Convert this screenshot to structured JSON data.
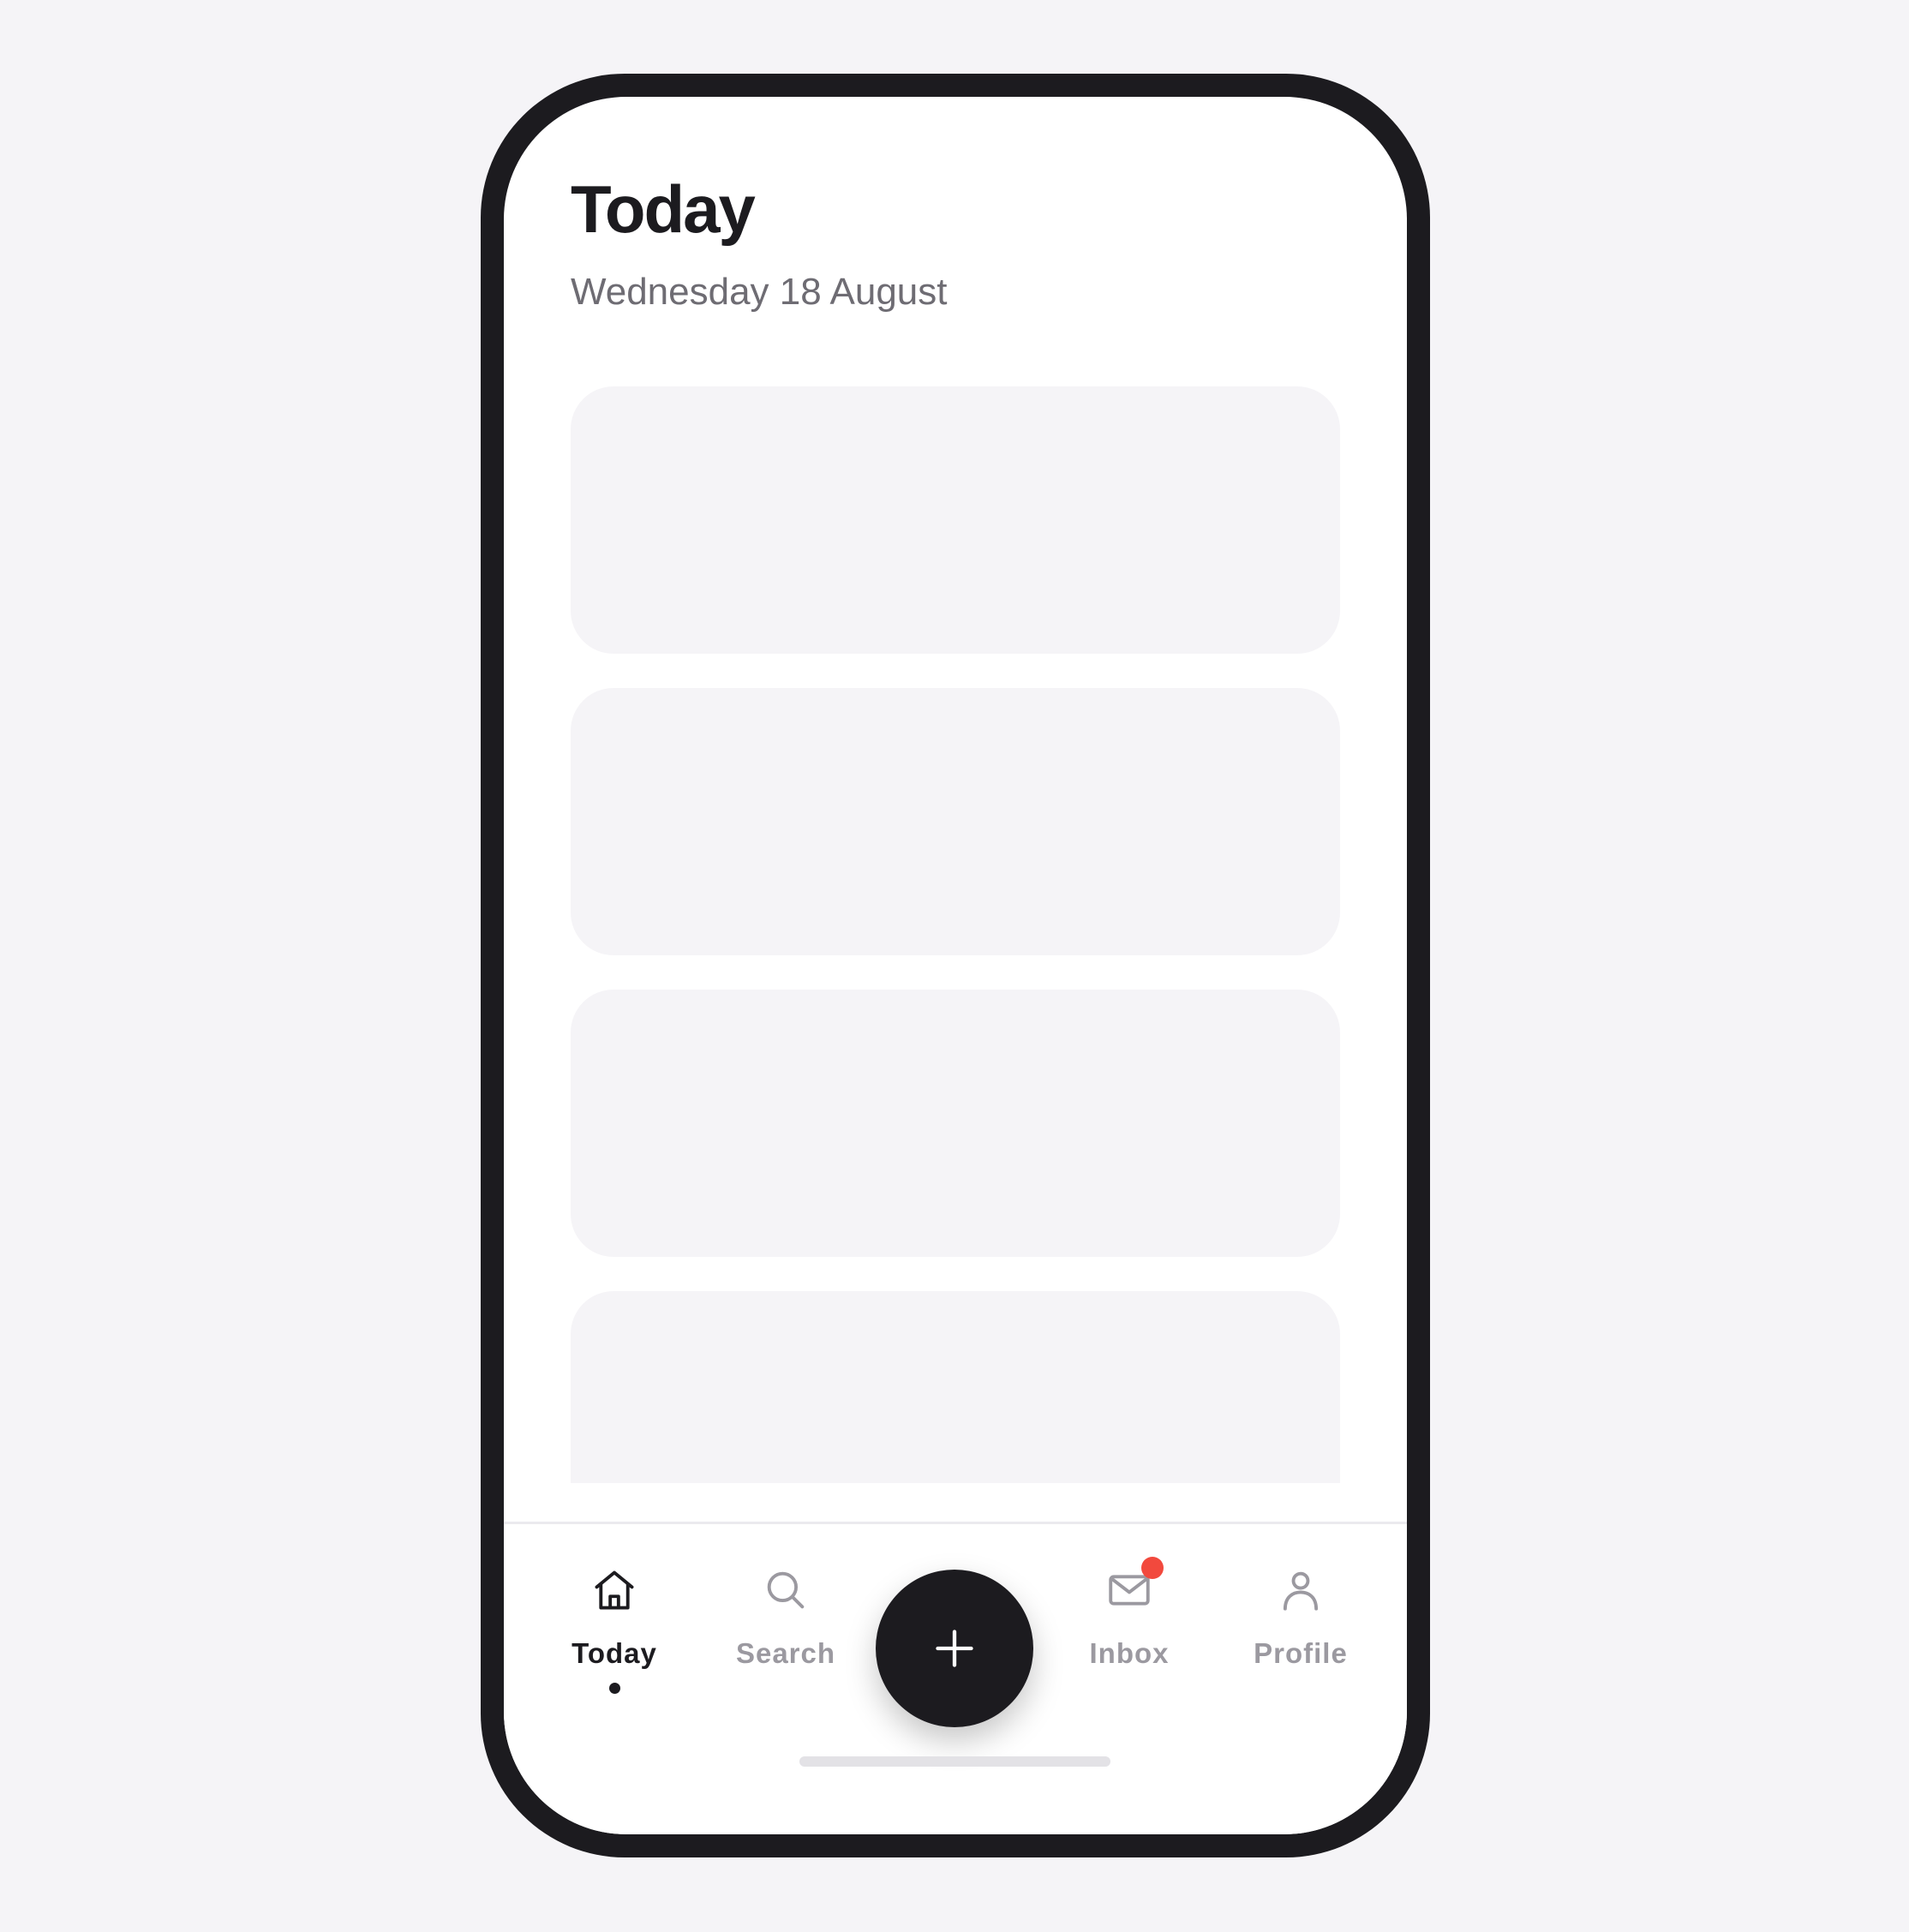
{
  "header": {
    "title": "Today",
    "date": "Wednesday 18 August"
  },
  "cards": [
    {
      "state": "skeleton"
    },
    {
      "state": "skeleton"
    },
    {
      "state": "skeleton"
    },
    {
      "state": "skeleton"
    }
  ],
  "tabbar": {
    "active_tab": "Today",
    "tabs": [
      {
        "label": "Today",
        "icon": "home-icon"
      },
      {
        "label": "Search",
        "icon": "search-icon"
      },
      {
        "label": "Inbox",
        "icon": "mail-icon",
        "has_notification": true
      },
      {
        "label": "Profile",
        "icon": "person-icon"
      }
    ],
    "fab_icon": "plus-icon"
  },
  "colors": {
    "background": "#f5f4f7",
    "frame": "#1c1b1f",
    "text_primary": "#1c1b1f",
    "text_secondary": "#6e6c73",
    "tab_inactive": "#9b99a0",
    "card_placeholder": "#f5f4f7",
    "notification": "#f2493d"
  }
}
